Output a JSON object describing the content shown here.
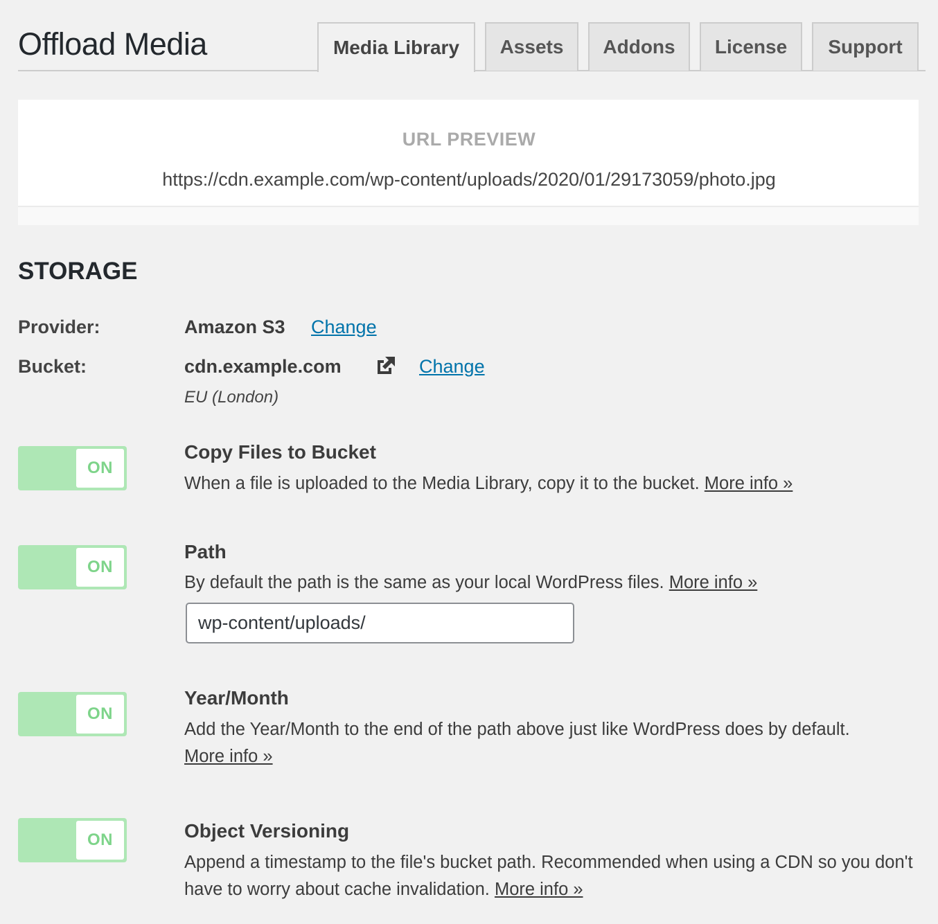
{
  "header": {
    "title": "Offload Media",
    "tabs": [
      {
        "label": "Media Library",
        "active": true
      },
      {
        "label": "Assets",
        "active": false
      },
      {
        "label": "Addons",
        "active": false
      },
      {
        "label": "License",
        "active": false
      },
      {
        "label": "Support",
        "active": false
      }
    ]
  },
  "url_preview": {
    "heading": "URL PREVIEW",
    "url": "https://cdn.example.com/wp-content/uploads/2020/01/29173059/photo.jpg"
  },
  "storage": {
    "section_title": "STORAGE",
    "provider": {
      "label": "Provider:",
      "value": "Amazon S3",
      "change_label": "Change"
    },
    "bucket": {
      "label": "Bucket:",
      "value": "cdn.example.com",
      "icon": "external-link-icon",
      "change_label": "Change",
      "region": "EU (London)"
    }
  },
  "options": [
    {
      "toggle": "ON",
      "title": "Copy Files to Bucket",
      "description": "When a file is uploaded to the Media Library, copy it to the bucket.",
      "more_info": "More info »"
    },
    {
      "toggle": "ON",
      "title": "Path",
      "description": "By default the path is the same as your local WordPress files.",
      "more_info": "More info »",
      "input_value": "wp-content/uploads/"
    },
    {
      "toggle": "ON",
      "title": "Year/Month",
      "description": "Add the Year/Month to the end of the path above just like WordPress does by default.",
      "more_info": "More info »"
    },
    {
      "toggle": "ON",
      "title": "Object Versioning",
      "description": "Append a timestamp to the file's bucket path. Recommended when using a CDN so you don't have to worry about cache invalidation.",
      "more_info": "More info »"
    }
  ],
  "colors": {
    "link": "#0073aa",
    "toggle_on_bg": "#aee7b5",
    "toggle_on_text": "#7ed48a",
    "page_bg": "#f1f1f1"
  }
}
